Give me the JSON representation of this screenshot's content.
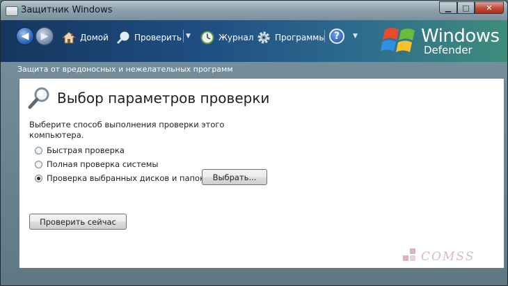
{
  "window": {
    "title": "Защитник Windows"
  },
  "toolbar": {
    "home_label": "Домой",
    "scan_label": "Проверить",
    "history_label": "Журнал",
    "tools_label": "Программы",
    "brand_line1": "Windows",
    "brand_line2": "Defender"
  },
  "subtitle": "Защита от вредоносных и нежелательных программ",
  "main": {
    "heading": "Выбор параметров проверки",
    "description": "Выберите способ выполнения проверки этого компьютера.",
    "options": [
      {
        "label": "Быстрая проверка",
        "checked": false
      },
      {
        "label": "Полная проверка системы",
        "checked": false
      },
      {
        "label": "Проверка выбранных дисков и папок",
        "checked": true
      }
    ],
    "choose_button": "Выбрать...",
    "scan_now_button": "Проверить сейчас"
  },
  "watermark": "COMSS",
  "colors": {
    "toolbar_start": "#16365f",
    "toolbar_end": "#3f8c7c",
    "close_button": "#c14a36"
  }
}
